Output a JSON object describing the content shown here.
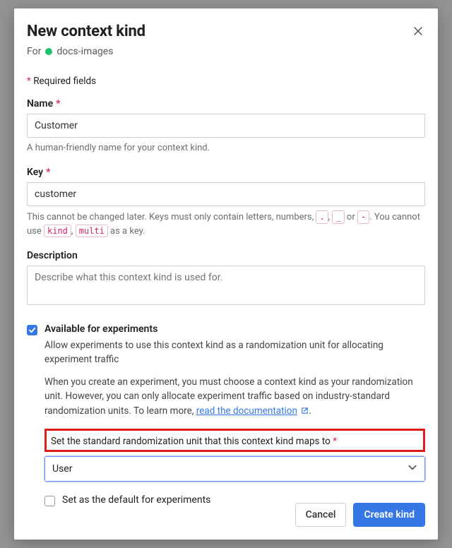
{
  "modal": {
    "title": "New context kind",
    "for_prefix": "For",
    "project_name": "docs-images",
    "required_note": "Required fields"
  },
  "name_field": {
    "label": "Name",
    "value": "Customer",
    "help": "A human-friendly name for your context kind."
  },
  "key_field": {
    "label": "Key",
    "value": "customer",
    "help_pre": "This cannot be changed later. Keys must only contain letters, numbers, ",
    "tok1": ".",
    "sep1": ", ",
    "tok2": "_",
    "sep2": " or ",
    "tok3": "-",
    "help_mid": ". You cannot use ",
    "tok4": "kind",
    "sep3": ", ",
    "tok5": "multi",
    "help_post": " as a key."
  },
  "desc_field": {
    "label": "Description",
    "placeholder": "Describe what this context kind is used for."
  },
  "exp": {
    "checkbox_label": "Available for experiments",
    "sub1": "Allow experiments to use this context kind as a randomization unit for allocating experiment traffic",
    "sub2_pre": "When you create an experiment, you must choose a context kind as your randomization unit. However, you can only allocate experiment traffic based on industry-standard randomization units. To learn more, ",
    "link_text": "read the documentation",
    "sub2_post": ".",
    "highlight_text": "Set the standard randomization unit that this context kind maps to",
    "select_value": "User",
    "default_label": "Set as the default for experiments"
  },
  "footer": {
    "cancel": "Cancel",
    "create": "Create kind"
  },
  "asterisk": "*"
}
